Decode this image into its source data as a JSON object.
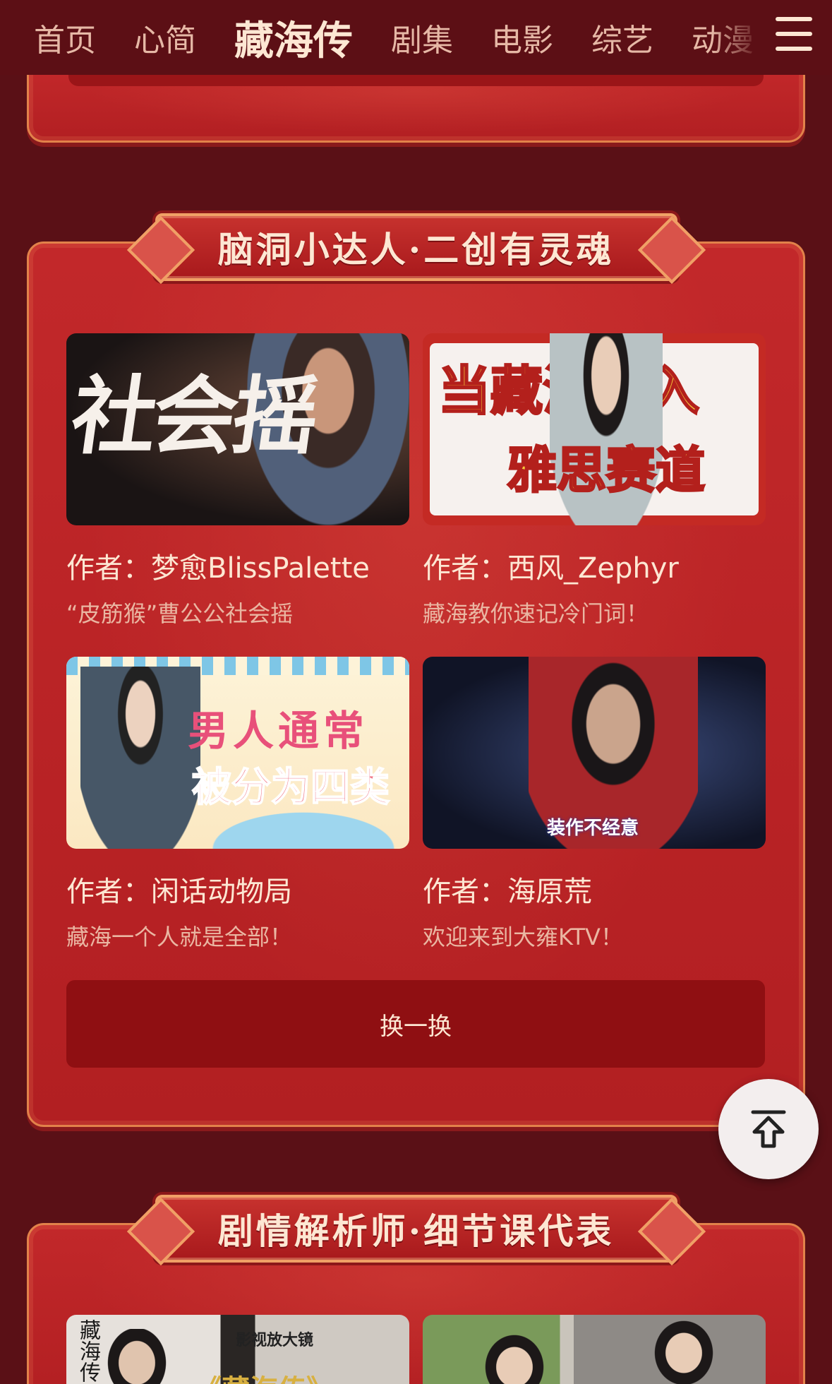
{
  "nav": {
    "items": [
      "首页",
      "心简",
      "藏海传",
      "剧集",
      "电影",
      "综艺",
      "动漫"
    ],
    "active_index": 2,
    "menu_icon": "hamburger-menu-icon"
  },
  "section1": {
    "banner_title": "脑洞小达人·二创有灵魂",
    "cards": [
      {
        "thumb_text": "社会摇",
        "author": "作者：梦愈BlissPalette",
        "desc": "“皮筋猴”曹公公社会摇"
      },
      {
        "thumb_text_1": "当藏海闯入",
        "thumb_text_2": "雅思赛道",
        "author": "作者：西风_Zephyr",
        "desc": "藏海教你速记冷门词！"
      },
      {
        "thumb_text_1": "男人通常",
        "thumb_text_2": "被分为四类",
        "author": "作者：闲话动物局",
        "desc": "藏海一个人就是全部！"
      },
      {
        "subtitle": "装作不经意",
        "author": "作者：海原荒",
        "desc": "欢迎来到大雍KTV！"
      }
    ],
    "refresh_label": "换一换"
  },
  "back_to_top_icon": "back-to-top-icon",
  "section2": {
    "banner_title": "剧情解析师·细节课代表",
    "cards": [
      {
        "thumb_text_1": "影视放大镜",
        "thumb_text_2": "《藏海传》",
        "logo_text": "藏海传"
      },
      {}
    ]
  },
  "colors": {
    "background": "#5a1016",
    "panel": "#b21f22",
    "accent_border": "#e2824a",
    "text_primary": "#fde7d3",
    "text_secondary": "#eab6a2",
    "button": "#8f0f12"
  }
}
